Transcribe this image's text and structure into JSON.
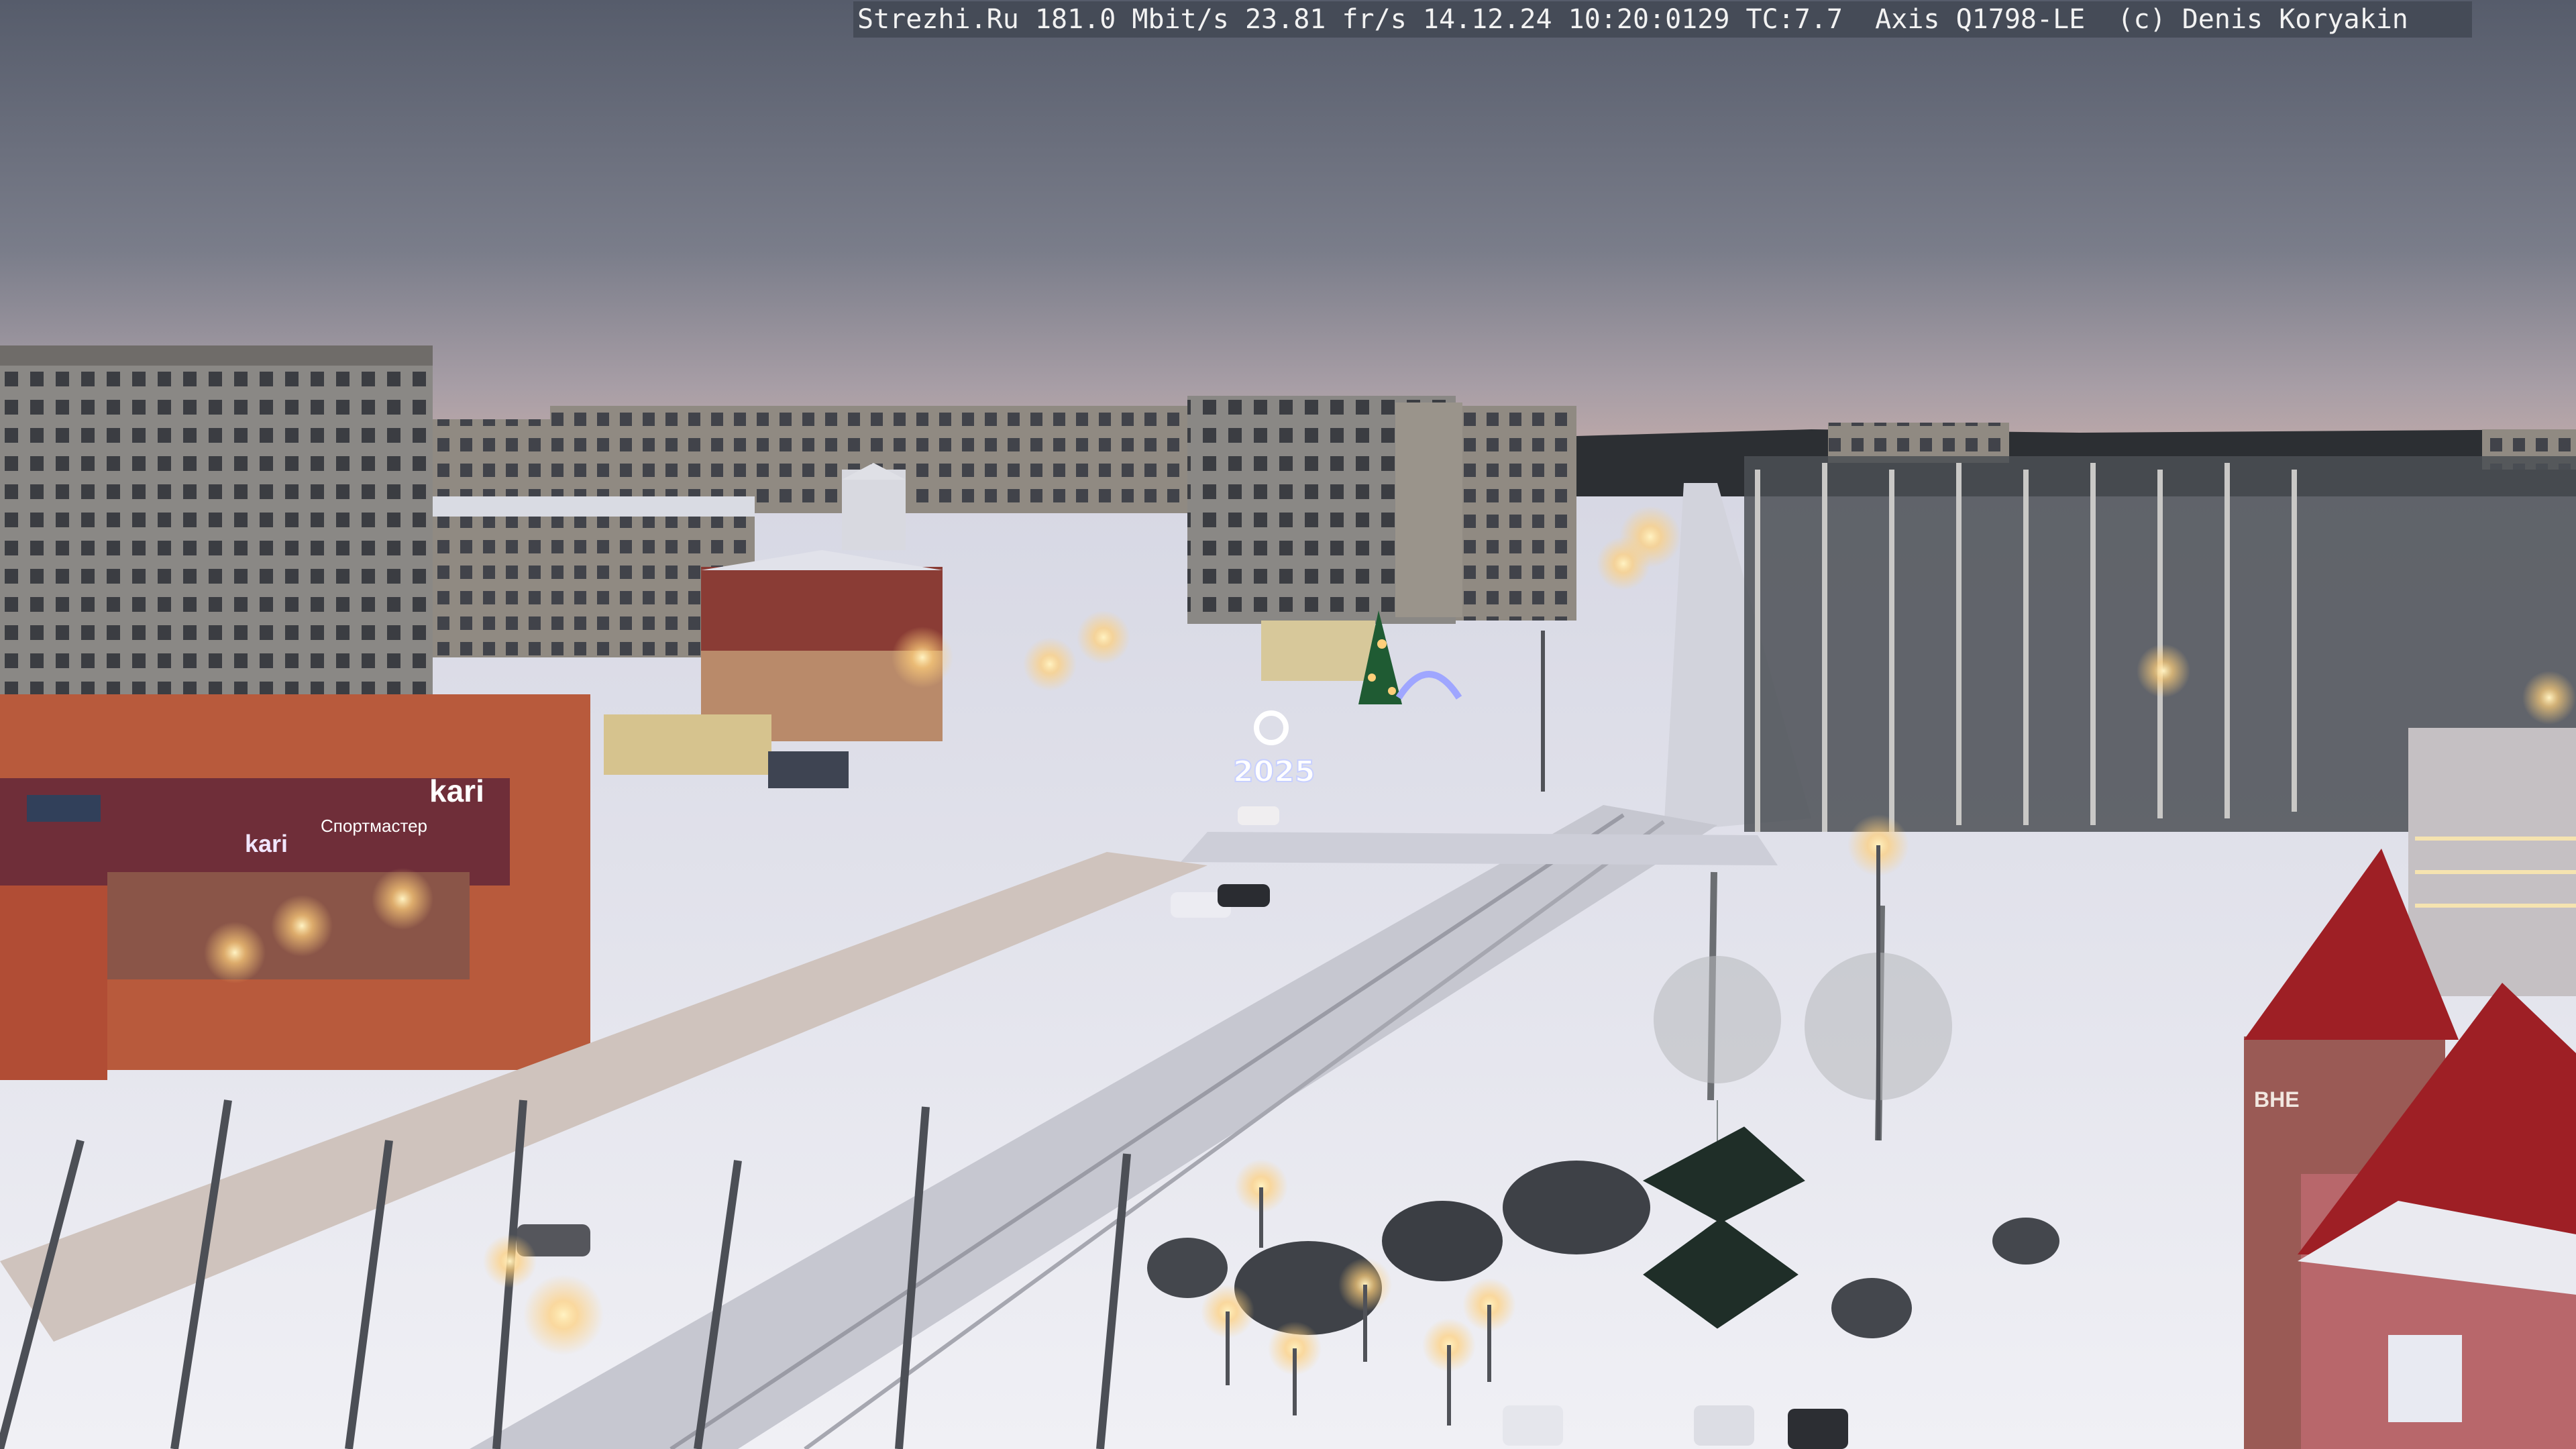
{
  "overlay": {
    "caption": "Strezhi.Ru 181.0 Mbit/s 23.81 fr/s 14.12.24 10:20:0129 TC:7.7  Axis Q1798-LE  (c) Denis Koryakin"
  },
  "signs": {
    "store_logo": "kari",
    "store_sign_small": "kari",
    "store_banner": "Спортмастер",
    "store_building_sign": "ВНЕ",
    "year_display": "2025"
  },
  "colors": {
    "sky_top": "#565c6b",
    "sky_horizon": "#b8a7a8",
    "snow": "#e8e9f0",
    "street_light": "#ffcf7a",
    "store_facade": "#b85a3c",
    "roof_red": "#9e1f25"
  }
}
